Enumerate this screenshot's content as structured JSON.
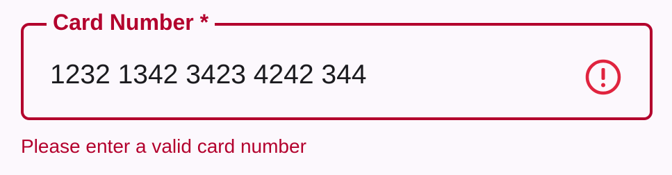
{
  "card_field": {
    "label": "Card Number *",
    "value": "1232 1342 3423 4242 344",
    "error_icon": "error-exclamation-circle-icon",
    "error_message": "Please enter a valid card number"
  },
  "colors": {
    "error": "#b3002d",
    "error_icon": "#e0243f",
    "text": "#1b1b1f",
    "background": "#fcf8fd"
  }
}
